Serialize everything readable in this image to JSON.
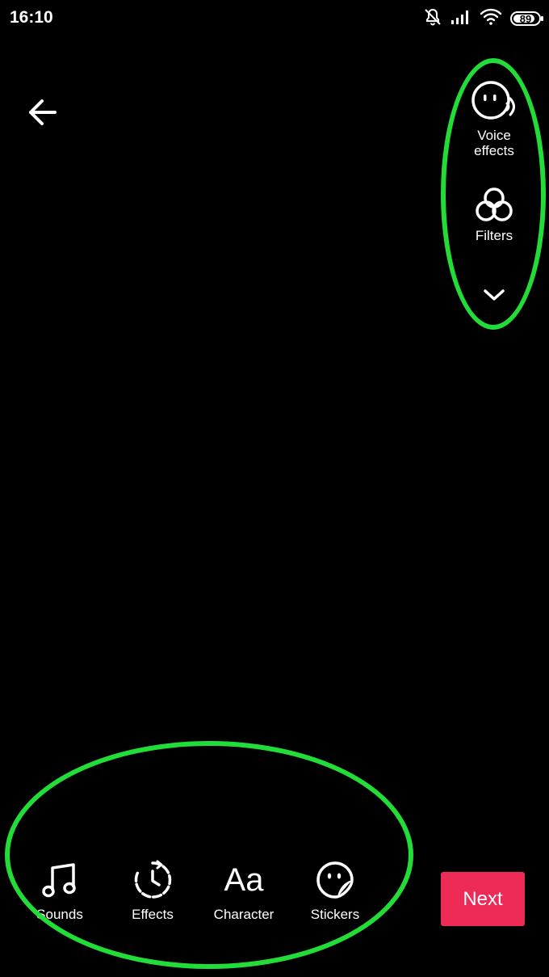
{
  "status_bar": {
    "time": "16:10",
    "battery_level": "89",
    "icons": [
      "notifications-muted-icon",
      "signal-icon",
      "wifi-icon",
      "battery-icon"
    ]
  },
  "navigation": {
    "back_icon": "arrow-left-icon"
  },
  "side_tools": [
    {
      "label": "Voice\neffects",
      "icon": "voice-effects-icon"
    },
    {
      "label": "Filters",
      "icon": "filters-icon"
    }
  ],
  "side_more_icon": "chevron-down-icon",
  "bottom_toolbar": [
    {
      "label": "Sounds",
      "icon": "music-note-icon"
    },
    {
      "label": "Effects",
      "icon": "effects-clock-icon"
    },
    {
      "label": "Character",
      "icon": "text-aa-icon",
      "glyph": "Aa"
    },
    {
      "label": "Stickers",
      "icon": "sticker-icon"
    }
  ],
  "next_button": {
    "label": "Next"
  },
  "colors": {
    "background": "#000000",
    "accent": "#ee2a57",
    "highlight": "#22dd38"
  }
}
